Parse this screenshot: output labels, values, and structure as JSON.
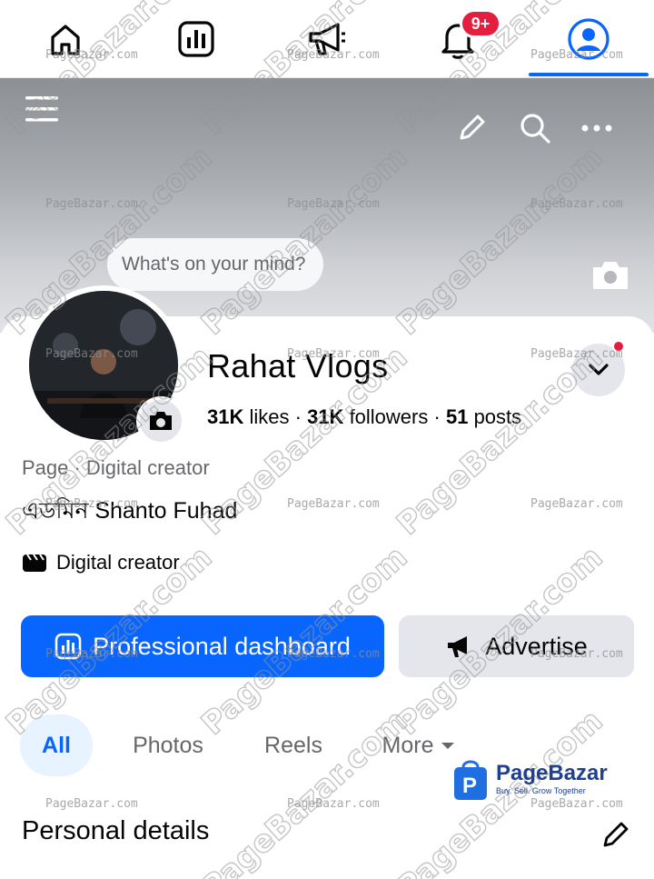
{
  "nav": {
    "items": [
      {
        "name": "home",
        "icon": "home-icon"
      },
      {
        "name": "dashboard",
        "icon": "bar-chart-icon"
      },
      {
        "name": "ads",
        "icon": "megaphone-icon"
      },
      {
        "name": "notifications",
        "icon": "bell-icon",
        "badge": "9+"
      },
      {
        "name": "profile",
        "icon": "profile-icon",
        "active": true
      }
    ],
    "accent": "#0866ff",
    "badge_color": "#e41e3f"
  },
  "cover": {
    "whats_on_mind": "What's on your mind?"
  },
  "profile": {
    "name": "Rahat Vlogs",
    "likes": "31K",
    "likes_label": "likes",
    "followers": "31K",
    "followers_label": "followers",
    "posts": "51",
    "posts_label": "posts",
    "separator": "·",
    "category_prefix": "Page",
    "category": "Digital creator",
    "category_line": "Page · Digital creator",
    "admin_line": "এডমিন Shanto Fuhad",
    "creator_label": "Digital creator"
  },
  "actions": {
    "professional_dashboard": "Professional dashboard",
    "advertise": "Advertise"
  },
  "tabs": [
    {
      "label": "All",
      "active": true
    },
    {
      "label": "Photos",
      "active": false
    },
    {
      "label": "Reels",
      "active": false
    },
    {
      "label": "More",
      "active": false
    }
  ],
  "sections": {
    "personal_details": "Personal details"
  },
  "watermark": {
    "text": "PageBazar.com",
    "small_text": "PageBazar.com",
    "logo_name": "PageBazar",
    "logo_tagline": "Buy. Sell. Grow Together"
  }
}
